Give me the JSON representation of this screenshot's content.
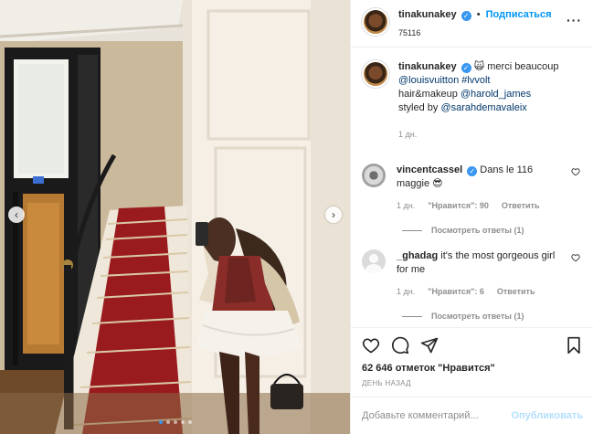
{
  "header": {
    "username": "tinakunakey",
    "separator": "•",
    "follow_label": "Подписаться",
    "location": "75116",
    "more_label": "···"
  },
  "photo": {
    "alt": "mirror selfie in a hallway with red carpeted staircase and elevator",
    "dots_count": 5,
    "active_dot": 0
  },
  "caption": {
    "username": "tinakunakey",
    "text_1": "merci beaucoup",
    "emoji": "🙀",
    "mention_1": "@louisvuitton",
    "hashtag": "#lvvolt",
    "text_2": "hair&makeup",
    "mention_2": "@harold_james",
    "text_3": "styled by",
    "mention_3": "@sarahdemavaleix",
    "time": "1 дн."
  },
  "comments": [
    {
      "username": "vincentcassel",
      "verified": true,
      "text": "Dans le 116 maggie 😎",
      "time": "1 дн.",
      "likes": "\"Нравится\": 90",
      "reply_label": "Ответить",
      "view_replies": "Посмотреть ответы (1)"
    },
    {
      "username": "_ghadag",
      "verified": false,
      "text": "it's the most gorgeous girl for me",
      "time": "1 дн.",
      "likes": "\"Нравится\": 6",
      "reply_label": "Ответить",
      "view_replies": "Посмотреть ответы (1)"
    }
  ],
  "actions": {
    "likes_count": "62 646",
    "likes_word": "отметок \"Нравится\"",
    "date": "ДЕНЬ НАЗАД"
  },
  "composer": {
    "placeholder": "Добавьте комментарий...",
    "publish_label": "Опубликовать"
  },
  "icons": {
    "like": "heart-icon",
    "comment": "comment-icon",
    "share": "share-icon",
    "save": "bookmark-icon"
  },
  "colors": {
    "accent": "#0095f6",
    "verified": "#3897f0",
    "publish_disabled": "#b2dffc",
    "carpet": "#9a1b1e"
  }
}
